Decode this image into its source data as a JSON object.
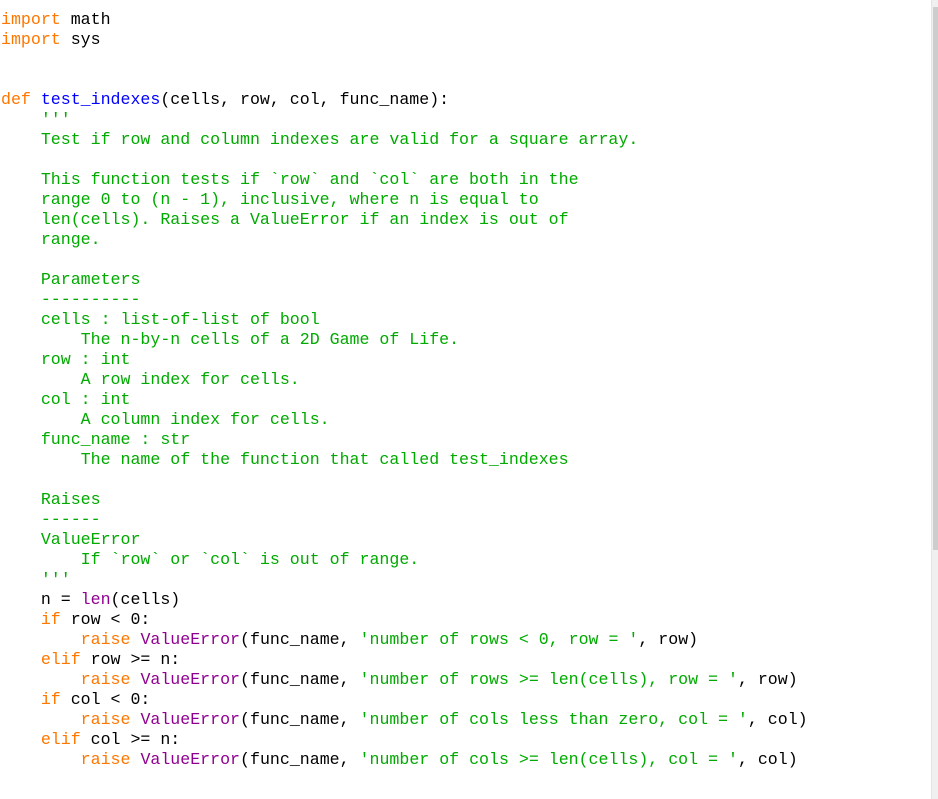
{
  "editor": {
    "lines": [
      [
        {
          "t": "kw",
          "v": "import"
        },
        {
          "t": "",
          "v": " math"
        }
      ],
      [
        {
          "t": "kw",
          "v": "import"
        },
        {
          "t": "",
          "v": " sys"
        }
      ],
      [],
      [],
      [
        {
          "t": "kw",
          "v": "def"
        },
        {
          "t": "",
          "v": " "
        },
        {
          "t": "def",
          "v": "test_indexes"
        },
        {
          "t": "",
          "v": "(cells, row, col, func_name):"
        }
      ],
      [
        {
          "t": "str",
          "v": "    '''"
        }
      ],
      [
        {
          "t": "str",
          "v": "    Test if row and column indexes are valid for a square array."
        }
      ],
      [],
      [
        {
          "t": "str",
          "v": "    This function tests if `row` and `col` are both in the"
        }
      ],
      [
        {
          "t": "str",
          "v": "    range 0 to (n - 1), inclusive, where n is equal to"
        }
      ],
      [
        {
          "t": "str",
          "v": "    len(cells). Raises a ValueError if an index is out of"
        }
      ],
      [
        {
          "t": "str",
          "v": "    range."
        }
      ],
      [],
      [
        {
          "t": "str",
          "v": "    Parameters"
        }
      ],
      [
        {
          "t": "str",
          "v": "    ----------"
        }
      ],
      [
        {
          "t": "str",
          "v": "    cells : list-of-list of bool"
        }
      ],
      [
        {
          "t": "str",
          "v": "        The n-by-n cells of a 2D Game of Life."
        }
      ],
      [
        {
          "t": "str",
          "v": "    row : int"
        }
      ],
      [
        {
          "t": "str",
          "v": "        A row index for cells."
        }
      ],
      [
        {
          "t": "str",
          "v": "    col : int"
        }
      ],
      [
        {
          "t": "str",
          "v": "        A column index for cells."
        }
      ],
      [
        {
          "t": "str",
          "v": "    func_name : str"
        }
      ],
      [
        {
          "t": "str",
          "v": "        The name of the function that called test_indexes"
        }
      ],
      [],
      [
        {
          "t": "str",
          "v": "    Raises"
        }
      ],
      [
        {
          "t": "str",
          "v": "    ------"
        }
      ],
      [
        {
          "t": "str",
          "v": "    ValueError"
        }
      ],
      [
        {
          "t": "str",
          "v": "        If `row` or `col` is out of range."
        }
      ],
      [
        {
          "t": "str",
          "v": "    '''"
        }
      ],
      [
        {
          "t": "",
          "v": "    n = "
        },
        {
          "t": "bi",
          "v": "len"
        },
        {
          "t": "",
          "v": "(cells)"
        }
      ],
      [
        {
          "t": "",
          "v": "    "
        },
        {
          "t": "kw",
          "v": "if"
        },
        {
          "t": "",
          "v": " row < 0:"
        }
      ],
      [
        {
          "t": "",
          "v": "        "
        },
        {
          "t": "kw",
          "v": "raise"
        },
        {
          "t": "",
          "v": " "
        },
        {
          "t": "bi",
          "v": "ValueError"
        },
        {
          "t": "",
          "v": "(func_name, "
        },
        {
          "t": "str",
          "v": "'number of rows < 0, row = '"
        },
        {
          "t": "",
          "v": ", row)"
        }
      ],
      [
        {
          "t": "",
          "v": "    "
        },
        {
          "t": "kw",
          "v": "elif"
        },
        {
          "t": "",
          "v": " row >= n:"
        }
      ],
      [
        {
          "t": "",
          "v": "        "
        },
        {
          "t": "kw",
          "v": "raise"
        },
        {
          "t": "",
          "v": " "
        },
        {
          "t": "bi",
          "v": "ValueError"
        },
        {
          "t": "",
          "v": "(func_name, "
        },
        {
          "t": "str",
          "v": "'number of rows >= len(cells), row = '"
        },
        {
          "t": "",
          "v": ", row)"
        }
      ],
      [
        {
          "t": "",
          "v": "    "
        },
        {
          "t": "kw",
          "v": "if"
        },
        {
          "t": "",
          "v": " col < 0:"
        }
      ],
      [
        {
          "t": "",
          "v": "        "
        },
        {
          "t": "kw",
          "v": "raise"
        },
        {
          "t": "",
          "v": " "
        },
        {
          "t": "bi",
          "v": "ValueError"
        },
        {
          "t": "",
          "v": "(func_name, "
        },
        {
          "t": "str",
          "v": "'number of cols less than zero, col = '"
        },
        {
          "t": "",
          "v": ", col)"
        }
      ],
      [
        {
          "t": "",
          "v": "    "
        },
        {
          "t": "kw",
          "v": "elif"
        },
        {
          "t": "",
          "v": " col >= n:"
        }
      ],
      [
        {
          "t": "",
          "v": "        "
        },
        {
          "t": "kw",
          "v": "raise"
        },
        {
          "t": "",
          "v": " "
        },
        {
          "t": "bi",
          "v": "ValueError"
        },
        {
          "t": "",
          "v": "(func_name, "
        },
        {
          "t": "str",
          "v": "'number of cols >= len(cells), col = '"
        },
        {
          "t": "",
          "v": ", col)"
        }
      ]
    ]
  },
  "colors": {
    "keyword": "#ff7700",
    "definition": "#0000ff",
    "string": "#00aa00",
    "builtin": "#900090",
    "text": "#000000"
  }
}
